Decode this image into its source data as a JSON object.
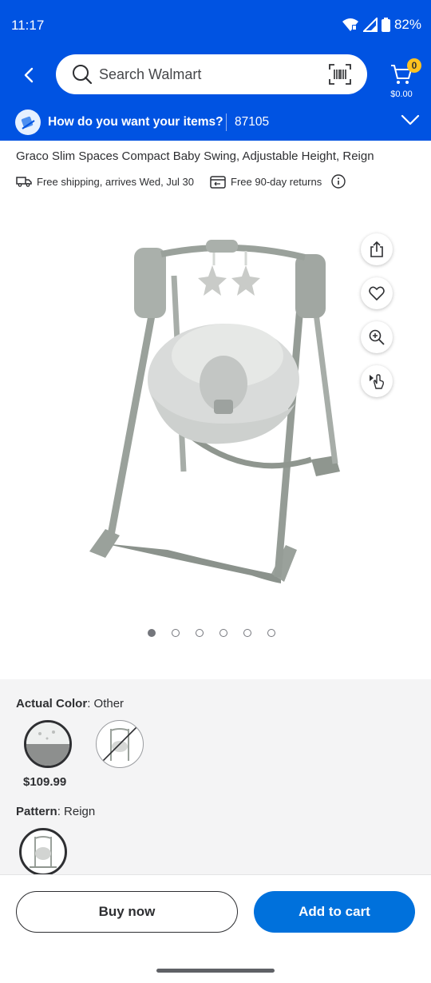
{
  "status_bar": {
    "time": "11:17",
    "battery": "82%"
  },
  "header": {
    "search": {
      "placeholder": "Search Walmart"
    },
    "cart": {
      "count": "0",
      "total": "$0.00"
    }
  },
  "fulfillment": {
    "prompt": "How do you want your items?",
    "zip": "87105"
  },
  "product": {
    "title": "Graco Slim Spaces Compact Baby Swing, Adjustable Height, Reign",
    "shipping": "Free shipping, arrives Wed, Jul 30",
    "returns": "Free 90-day returns"
  },
  "gallery": {
    "image_count": 6,
    "active_index": 0
  },
  "variants": {
    "color_label": "Actual Color",
    "color_value": ": Other",
    "selected_price": "$109.99",
    "pattern_label": "Pattern",
    "pattern_value": ": Reign"
  },
  "actions": {
    "buy_now": "Buy now",
    "add_to_cart": "Add to cart"
  },
  "colors": {
    "brand_blue": "#0053e2",
    "button_blue": "#0071dc",
    "spark_yellow": "#ffc220"
  },
  "icons": [
    "back-icon",
    "search-icon",
    "barcode-icon",
    "cart-icon",
    "delivery-icon",
    "truck-icon",
    "returns-icon",
    "info-icon",
    "share-icon",
    "heart-icon",
    "zoom-icon",
    "view-3d-icon",
    "chevron-down-icon"
  ]
}
